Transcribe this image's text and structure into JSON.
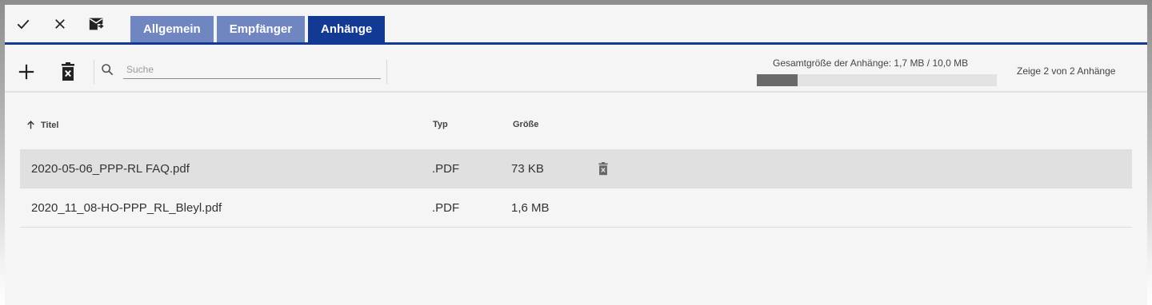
{
  "tabs": [
    {
      "label": "Allgemein",
      "active": false
    },
    {
      "label": "Empfänger",
      "active": false
    },
    {
      "label": "Anhänge",
      "active": true
    }
  ],
  "toolbar": {
    "icons": [
      "check-icon",
      "close-icon",
      "send-mail-icon"
    ]
  },
  "actions": {
    "icons": [
      "add-icon",
      "delete-icon"
    ],
    "search": {
      "placeholder": "Suche",
      "value": ""
    }
  },
  "attachments_size": {
    "label": "Gesamtgröße der Anhänge: 1,7 MB / 10,0 MB",
    "used_mb": 1.7,
    "max_mb": 10.0
  },
  "count_label": "Zeige 2 von 2 Anhänge",
  "table": {
    "columns": {
      "title": "Titel",
      "type": "Typ",
      "size": "Größe"
    },
    "sort": {
      "column": "title",
      "direction": "asc"
    },
    "rows": [
      {
        "title": "2020-05-06_PPP-RL FAQ.pdf",
        "type": ".PDF",
        "size": "73 KB",
        "selected": true
      },
      {
        "title": "2020_11_08-HO-PPP_RL_Bleyl.pdf",
        "type": ".PDF",
        "size": "1,6 MB",
        "selected": false
      }
    ]
  },
  "colors": {
    "tab_inactive": "#6f86c0",
    "tab_active": "#123a95",
    "progress_fill": "#6a6a6a",
    "selected_row": "#e0e0e0"
  }
}
